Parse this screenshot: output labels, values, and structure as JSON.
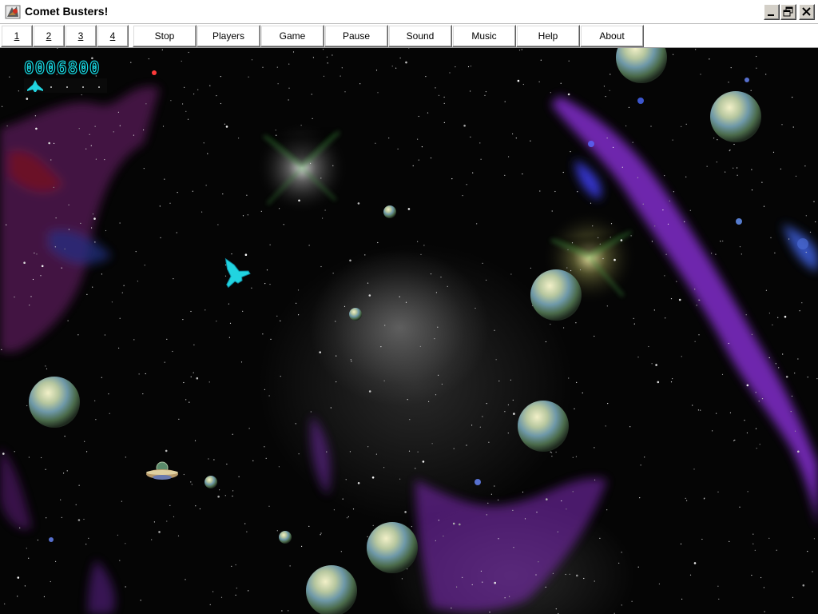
{
  "window": {
    "title": "Comet Busters!",
    "icon": "comet-busters-app-icon",
    "controls": [
      "minimize-icon",
      "restore-icon",
      "close-icon"
    ]
  },
  "menu": {
    "items": [
      {
        "key": "1",
        "label": "1"
      },
      {
        "key": "2",
        "label": "2"
      },
      {
        "key": "3",
        "label": "3"
      },
      {
        "key": "4",
        "label": "4"
      },
      {
        "key": "stop",
        "label": "Stop"
      },
      {
        "key": "players",
        "label": "Players"
      },
      {
        "key": "game",
        "label": "Game"
      },
      {
        "key": "pause",
        "label": "Pause"
      },
      {
        "key": "sound",
        "label": "Sound"
      },
      {
        "key": "music",
        "label": "Music"
      },
      {
        "key": "help",
        "label": "Help"
      },
      {
        "key": "about",
        "label": "About"
      }
    ]
  },
  "hud": {
    "score": "0006800",
    "lives": 1,
    "score_color": "#17d6e0"
  },
  "colors": {
    "ship": "#21d4e0",
    "nebula_purple": "#7a1fb5",
    "nebula_magenta": "#9a2a8f",
    "asteroid_highlight": "#e4e2b4",
    "asteroid_shadow": "#3a4e3c"
  }
}
